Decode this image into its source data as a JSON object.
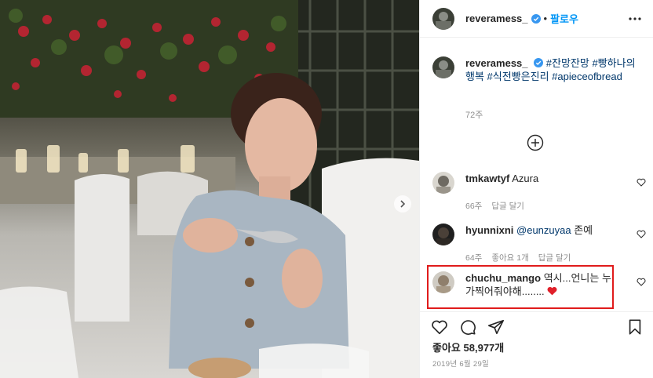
{
  "header": {
    "username": "reveramess_",
    "follow_label": "팔로우",
    "separator": "•"
  },
  "caption": {
    "username": "reveramess_",
    "hashtags": [
      "#잔망잔망",
      "#빵하나의행복",
      "#식전빵은진리",
      "#apieceofbread"
    ],
    "time": "72주"
  },
  "comments": [
    {
      "username": "tmkawtyf",
      "text": "Azura",
      "mention": "",
      "meta": [
        "66주",
        "답글 달기"
      ]
    },
    {
      "username": "hyunnixni",
      "mention": "@eunzuyaa",
      "text": "존예",
      "meta": [
        "64주",
        "좋아요 1개",
        "답글 달기"
      ]
    },
    {
      "username": "chuchu_mango",
      "mention": "",
      "text": "역시...언니는 누가찍어줘야해........",
      "emoji": "❤️",
      "meta": []
    }
  ],
  "likes": {
    "label": "좋아요",
    "count": "58,977개"
  },
  "post_date": "2019년 6월 29일",
  "icons": {
    "verified": "verified-badge-icon",
    "more": "more-options-icon",
    "load_more": "plus-circle-icon",
    "like": "heart-icon",
    "comment": "comment-bubble-icon",
    "share": "paper-plane-icon",
    "save": "bookmark-icon",
    "carousel_next": "chevron-right-icon"
  },
  "colors": {
    "link": "#0095f6",
    "hashtag": "#00376b",
    "secondary_text": "#8e8e8e",
    "verified": "#3897f0",
    "highlight_box": "#e01b1b",
    "heart_emoji": "#e0202a"
  }
}
